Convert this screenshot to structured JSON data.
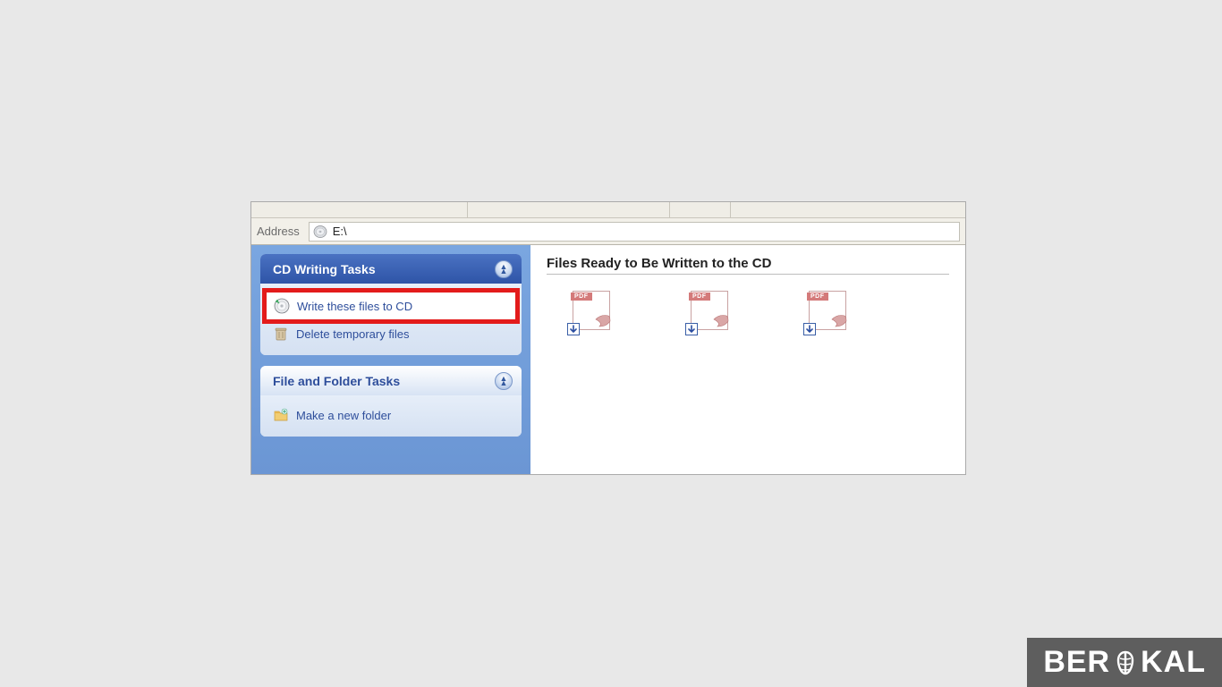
{
  "address": {
    "label": "Address",
    "path": "E:\\"
  },
  "sidebar": {
    "cd_tasks": {
      "title": "CD Writing Tasks",
      "items": [
        {
          "label": "Write these files to CD",
          "highlighted": true
        },
        {
          "label": "Delete temporary files",
          "highlighted": false
        }
      ]
    },
    "file_tasks": {
      "title": "File and Folder Tasks",
      "items": [
        {
          "label": "Make a new folder"
        }
      ]
    }
  },
  "main": {
    "section_heading": "Files Ready to Be Written to the CD",
    "pdf_badge": "PDF",
    "files": [
      {
        "type": "pdf"
      },
      {
        "type": "pdf"
      },
      {
        "type": "pdf"
      }
    ]
  },
  "watermark": {
    "text_left": "BER",
    "text_right": "KAL"
  }
}
